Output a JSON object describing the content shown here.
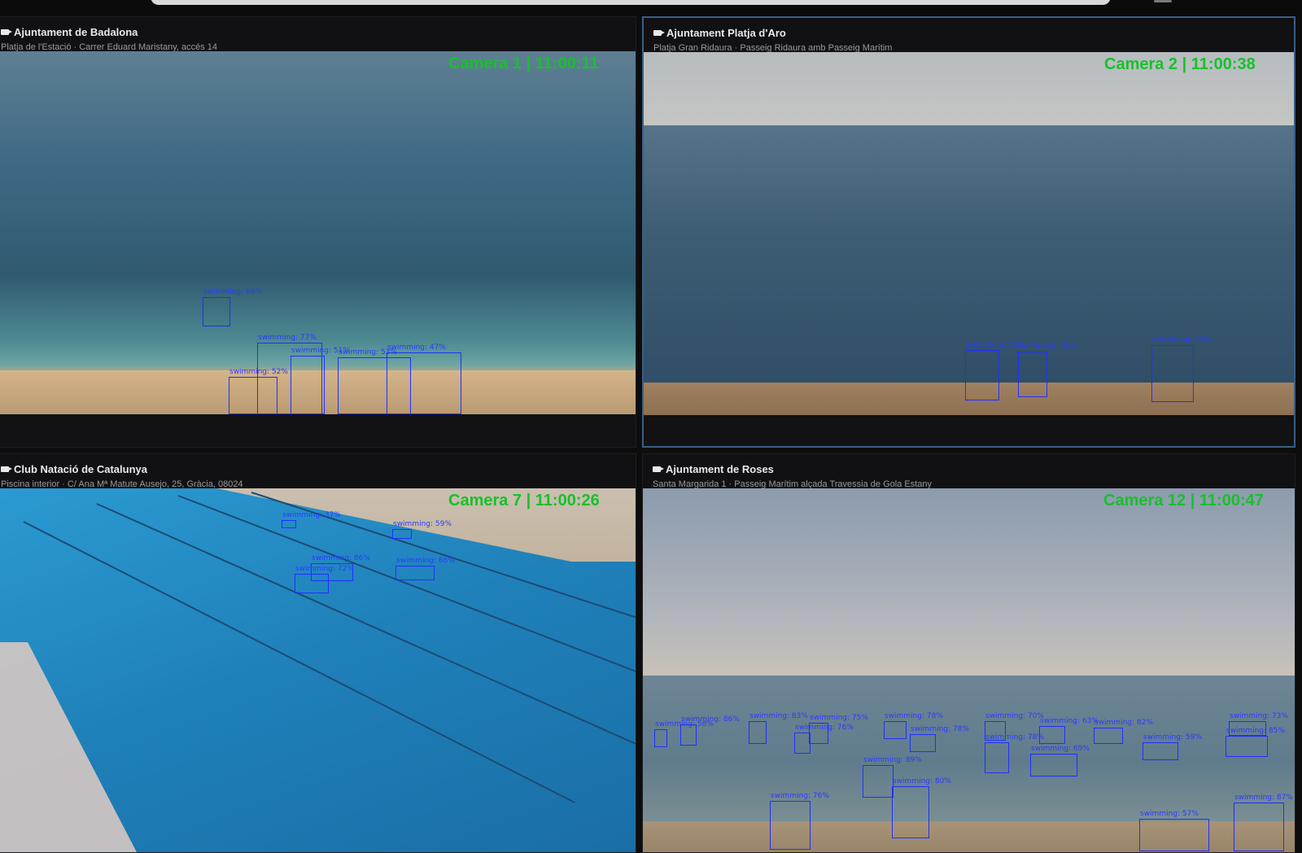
{
  "cameras": [
    {
      "title": "Ajuntament de Badalona",
      "subtitle": "Platja de l'Estació · Carrer Eduard Maristany, accés 14",
      "overlay": "Camera 1 | 11:00:11",
      "detections": [
        "swimming: 69%",
        "swimming: 77%",
        "swimming: 51%",
        "swimming: 52%",
        "swimming: 53%",
        "swimming: 47%"
      ]
    },
    {
      "title": "Ajuntament Platja d'Aro",
      "subtitle": "Platja Gran Ridaura · Passeig Ridaura amb Passeig Marítim",
      "overlay": "Camera 2 | 11:00:38",
      "detections": [
        "swimming: 56%",
        "swimming: 58%",
        "swimming: 70%"
      ]
    },
    {
      "title": "Club Natació de Catalunya",
      "subtitle": "Piscina interior · C/ Ana Mª Matute Ausejo, 25, Gràcia, 08024",
      "overlay": "Camera 7 | 11:00:26",
      "detections": [
        "swimming: 37%",
        "swimming: 59%",
        "swimming: 86%",
        "swimming: 66%",
        "swimming: 72%"
      ]
    },
    {
      "title": "Ajuntament de Roses",
      "subtitle": "Santa Margarida 1 · Passeig Marítim alçada Travessia de Gola Estany",
      "overlay": "Camera 12 | 11:00:47",
      "detections": [
        "swimming: 86%",
        "swimming: 58%",
        "swimming: 83%",
        "swimming: 75%",
        "swimming: 78%",
        "swimming: 76%",
        "swimming: 70%",
        "swimming: 78%",
        "swimming: 63%",
        "swimming: 82%",
        "swimming: 73%",
        "swimming: 85%",
        "swimming: 59%",
        "swimming: 69%",
        "swimming: 78%",
        "swimming: 89%",
        "swimming: 76%",
        "swimming: 80%",
        "swimming: 57%",
        "swimming: 87%"
      ]
    }
  ],
  "colors": {
    "overlay_text": "#18c02c",
    "bbox": "#1f30ff",
    "active_border": "#3a5f86"
  }
}
